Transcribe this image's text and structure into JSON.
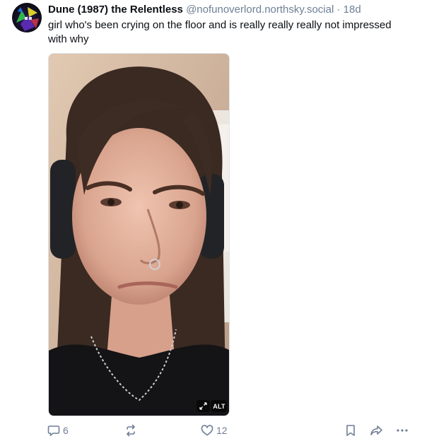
{
  "post": {
    "author": {
      "display_name": "Dune (1987) the Relentless",
      "handle": "@nofunoverlord.northsky.social",
      "time_separator": " · ",
      "timestamp": "18d"
    },
    "text": "girl who's been crying on the floor and is really really really not impressed with why",
    "media": {
      "alt_badge": "ALT",
      "expand_icon": "expand-icon"
    },
    "actions": {
      "reply_count": "6",
      "repost_count": "",
      "like_count": "12"
    }
  },
  "colors": {
    "text": "#0b0f14",
    "muted": "#6f7f95",
    "border": "#dfe4ea"
  }
}
